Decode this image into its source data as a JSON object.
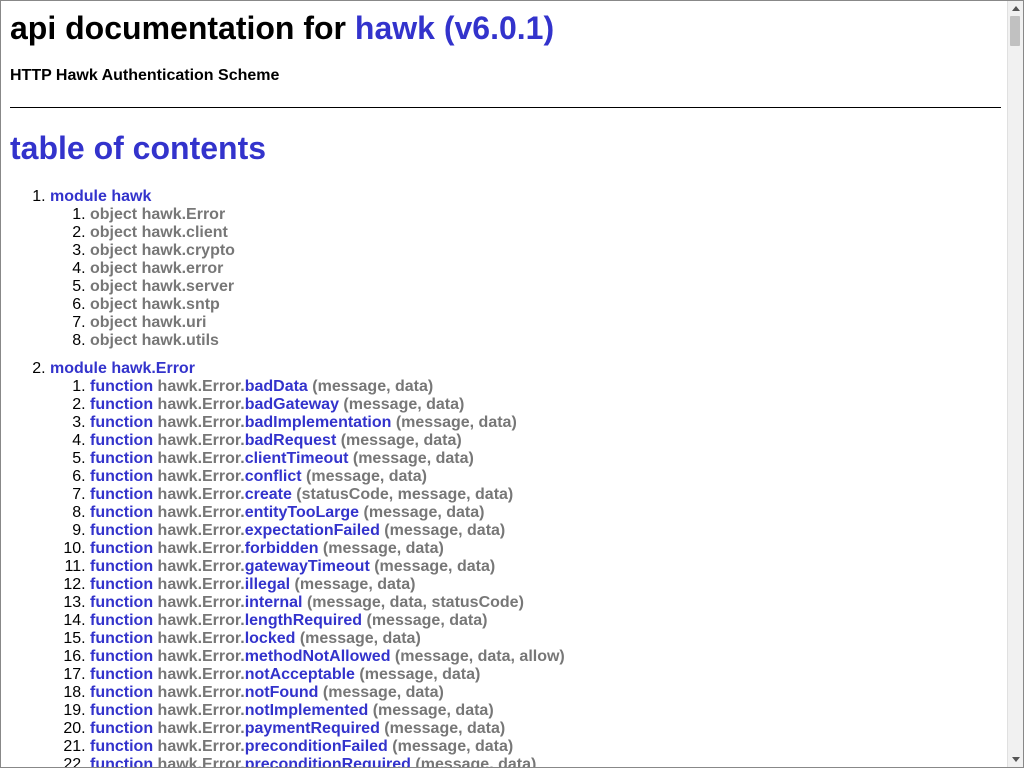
{
  "header": {
    "title_prefix": "api documentation for ",
    "package_label": "hawk (v6.0.1)",
    "subtitle": "HTTP Hawk Authentication Scheme"
  },
  "toc": {
    "title": "table of contents",
    "modules": [
      {
        "label": "module hawk",
        "entries": [
          {
            "kind": "object",
            "name": "hawk.Error"
          },
          {
            "kind": "object",
            "name": "hawk.client"
          },
          {
            "kind": "object",
            "name": "hawk.crypto"
          },
          {
            "kind": "object",
            "name": "hawk.error"
          },
          {
            "kind": "object",
            "name": "hawk.server"
          },
          {
            "kind": "object",
            "name": "hawk.sntp"
          },
          {
            "kind": "object",
            "name": "hawk.uri"
          },
          {
            "kind": "object",
            "name": "hawk.utils"
          }
        ]
      },
      {
        "label": "module hawk.Error",
        "entries": [
          {
            "kind": "function",
            "prefix": "hawk.Error.",
            "name": "badData",
            "args": " (message, data)"
          },
          {
            "kind": "function",
            "prefix": "hawk.Error.",
            "name": "badGateway",
            "args": " (message, data)"
          },
          {
            "kind": "function",
            "prefix": "hawk.Error.",
            "name": "badImplementation",
            "args": " (message, data)"
          },
          {
            "kind": "function",
            "prefix": "hawk.Error.",
            "name": "badRequest",
            "args": " (message, data)"
          },
          {
            "kind": "function",
            "prefix": "hawk.Error.",
            "name": "clientTimeout",
            "args": " (message, data)"
          },
          {
            "kind": "function",
            "prefix": "hawk.Error.",
            "name": "conflict",
            "args": " (message, data)"
          },
          {
            "kind": "function",
            "prefix": "hawk.Error.",
            "name": "create",
            "args": " (statusCode, message, data)"
          },
          {
            "kind": "function",
            "prefix": "hawk.Error.",
            "name": "entityTooLarge",
            "args": " (message, data)"
          },
          {
            "kind": "function",
            "prefix": "hawk.Error.",
            "name": "expectationFailed",
            "args": " (message, data)"
          },
          {
            "kind": "function",
            "prefix": "hawk.Error.",
            "name": "forbidden",
            "args": " (message, data)"
          },
          {
            "kind": "function",
            "prefix": "hawk.Error.",
            "name": "gatewayTimeout",
            "args": " (message, data)"
          },
          {
            "kind": "function",
            "prefix": "hawk.Error.",
            "name": "illegal",
            "args": " (message, data)"
          },
          {
            "kind": "function",
            "prefix": "hawk.Error.",
            "name": "internal",
            "args": " (message, data, statusCode)"
          },
          {
            "kind": "function",
            "prefix": "hawk.Error.",
            "name": "lengthRequired",
            "args": " (message, data)"
          },
          {
            "kind": "function",
            "prefix": "hawk.Error.",
            "name": "locked",
            "args": " (message, data)"
          },
          {
            "kind": "function",
            "prefix": "hawk.Error.",
            "name": "methodNotAllowed",
            "args": " (message, data, allow)"
          },
          {
            "kind": "function",
            "prefix": "hawk.Error.",
            "name": "notAcceptable",
            "args": " (message, data)"
          },
          {
            "kind": "function",
            "prefix": "hawk.Error.",
            "name": "notFound",
            "args": " (message, data)"
          },
          {
            "kind": "function",
            "prefix": "hawk.Error.",
            "name": "notImplemented",
            "args": " (message, data)"
          },
          {
            "kind": "function",
            "prefix": "hawk.Error.",
            "name": "paymentRequired",
            "args": " (message, data)"
          },
          {
            "kind": "function",
            "prefix": "hawk.Error.",
            "name": "preconditionFailed",
            "args": " (message, data)"
          },
          {
            "kind": "function",
            "prefix": "hawk.Error.",
            "name": "preconditionRequired",
            "args": " (message, data)"
          }
        ]
      }
    ]
  },
  "scrollbar": {
    "position_fraction": 0.0
  }
}
